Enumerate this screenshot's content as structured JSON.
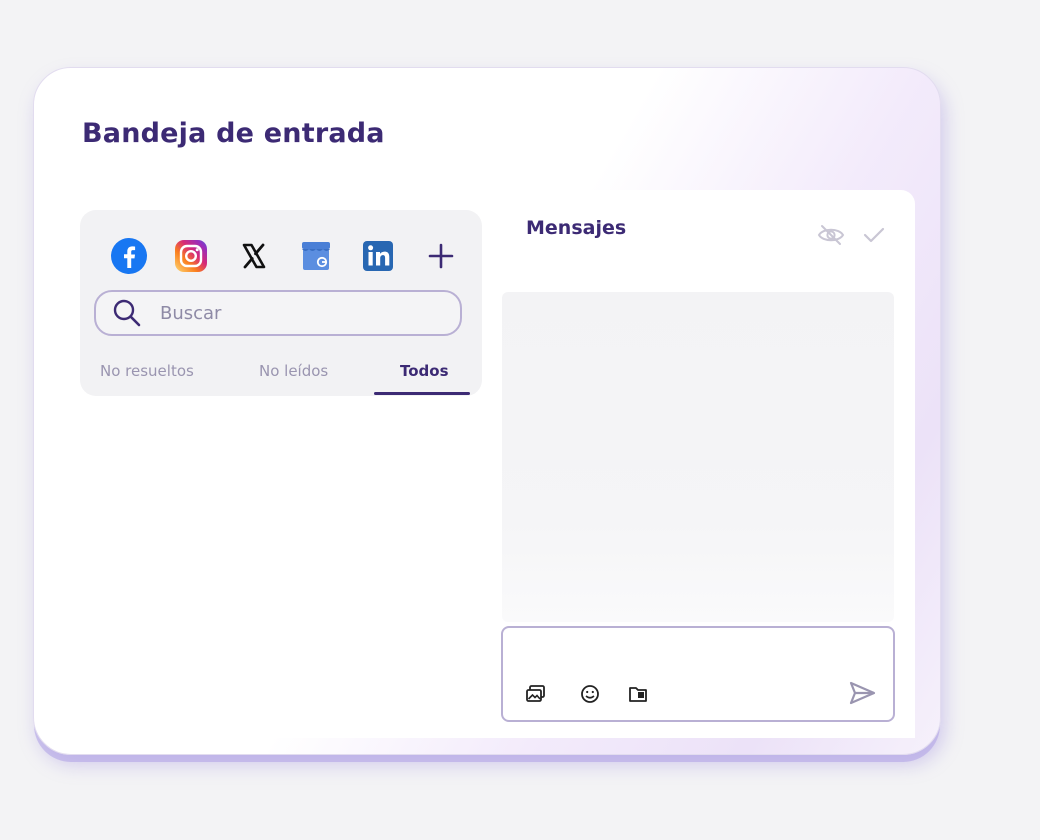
{
  "inbox": {
    "title": "Bandeja de entrada"
  },
  "channels": [
    {
      "name": "facebook-icon",
      "color": "#1877F2"
    },
    {
      "name": "instagram-icon",
      "color": "#E1306C"
    },
    {
      "name": "x-icon",
      "color": "#111111"
    },
    {
      "name": "store-icon",
      "color": "#4A7FD6"
    },
    {
      "name": "linkedin-icon",
      "color": "#2867B2"
    },
    {
      "name": "add-icon",
      "color": "#3C2A74"
    }
  ],
  "search": {
    "placeholder": "Buscar"
  },
  "tabs": [
    {
      "label": "No resueltos",
      "active": false
    },
    {
      "label": "No leídos",
      "active": false
    },
    {
      "label": "Todos",
      "active": true
    }
  ],
  "messages": {
    "title": "Mensajes"
  },
  "composer": {
    "tools": [
      "image-gallery-icon",
      "emoji-icon",
      "folder-icon"
    ],
    "send_icon": "send-icon"
  },
  "colors": {
    "brand": "#3C2A74",
    "border": "#B9B0D4",
    "muted": "#9A95B0"
  }
}
